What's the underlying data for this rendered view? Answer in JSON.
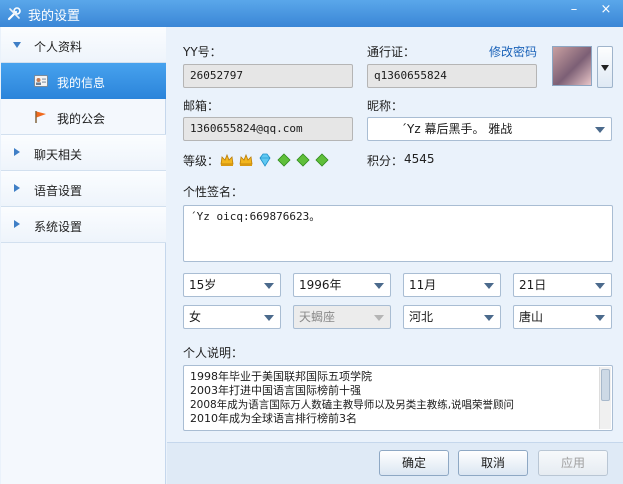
{
  "window": {
    "title": "我的设置",
    "minimize_glyph": "–",
    "close_glyph": "×"
  },
  "sidebar": {
    "sections": [
      {
        "label": "个人资料",
        "expanded": true,
        "items": [
          {
            "label": "我的信息",
            "icon": "id-card-icon",
            "active": true
          },
          {
            "label": "我的公会",
            "icon": "flag-icon",
            "active": false
          }
        ]
      },
      {
        "label": "聊天相关",
        "expanded": false
      },
      {
        "label": "语音设置",
        "expanded": false
      },
      {
        "label": "系统设置",
        "expanded": false
      }
    ]
  },
  "profile": {
    "yy_label": "YY号：",
    "yy_value": "26052797",
    "passport_label": "通行证：",
    "passport_value": "q1360655824",
    "change_password": "修改密码",
    "email_label": "邮箱：",
    "email_value": "1360655824@qq.com",
    "nickname_label": "昵称：",
    "nickname_value": "´Yz  幕后黑手。 雅战",
    "level_label": "等级：",
    "level_icons": [
      "crown-icon",
      "crown-icon",
      "diamond-icon",
      "leaf-icon",
      "leaf-icon",
      "leaf-icon"
    ],
    "points_label": "积分：",
    "points_value": "4545",
    "signature_label": "个性签名：",
    "signature_value": "´Yz oicq:669876623。",
    "age": "15岁",
    "birth_year": "1996年",
    "birth_month": "11月",
    "birth_day": "21日",
    "gender": "女",
    "zodiac": "天蝎座",
    "province": "河北",
    "city": "唐山",
    "bio_label": "个人说明：",
    "bio_lines": [
      "1998年毕业于美国联邦国际五项学院",
      "2003年打进中国语言国际榜前十强",
      "2008年成为语言国际万人数磕主教导师以及另类主教练,说唱荣誉顾问",
      "2010年成为全球语言排行榜前3名"
    ]
  },
  "buttons": {
    "ok": "确定",
    "cancel": "取消",
    "apply": "应用"
  },
  "colors": {
    "titlebar": "#3a86d6",
    "active_nav": "#2b84da",
    "link": "#1b63b9"
  }
}
